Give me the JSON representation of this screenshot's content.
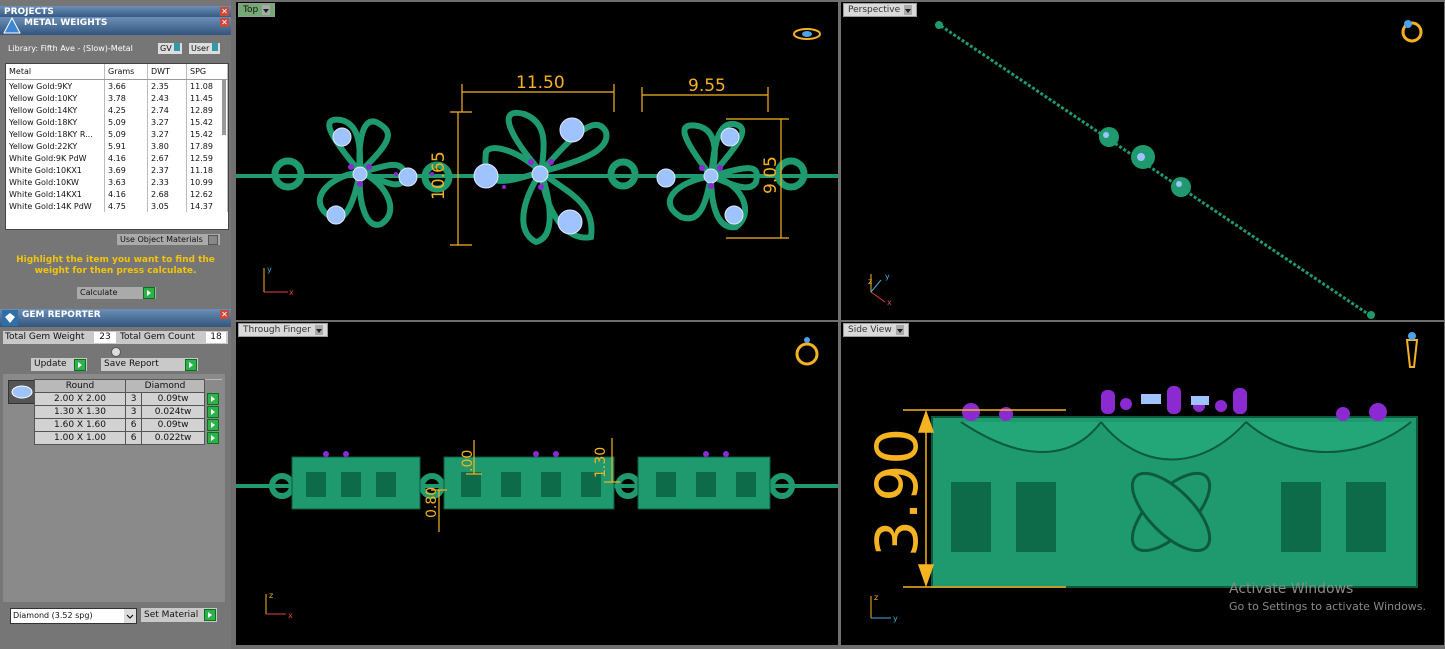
{
  "projects": {
    "title": "PROJECTS"
  },
  "metal_weights": {
    "title": "METAL WEIGHTS",
    "library": "Library: Fifth Ave - (Slow)-Metal",
    "gv_label": "GV",
    "user_label": "User",
    "columns": [
      "Metal",
      "Grams",
      "DWT",
      "SPG"
    ],
    "rows": [
      [
        "Yellow Gold:9KY",
        "3.66",
        "2.35",
        "11.08"
      ],
      [
        "Yellow Gold:10KY",
        "3.78",
        "2.43",
        "11.45"
      ],
      [
        "Yellow Gold:14KY",
        "4.25",
        "2.74",
        "12.89"
      ],
      [
        "Yellow Gold:18KY",
        "5.09",
        "3.27",
        "15.42"
      ],
      [
        "Yellow Gold:18KY R...",
        "5.09",
        "3.27",
        "15.42"
      ],
      [
        "Yellow Gold:22KY",
        "5.91",
        "3.80",
        "17.89"
      ],
      [
        "White Gold:9K PdW",
        "4.16",
        "2.67",
        "12.59"
      ],
      [
        "White Gold:10KX1",
        "3.69",
        "2.37",
        "11.18"
      ],
      [
        "White Gold:10KW",
        "3.63",
        "2.33",
        "10.99"
      ],
      [
        "White Gold:14KX1",
        "4.16",
        "2.68",
        "12.62"
      ],
      [
        "White Gold:14K PdW",
        "4.75",
        "3.05",
        "14.37"
      ]
    ],
    "use_object_materials": "Use Object Materials",
    "hint": "Highlight the item you want to find the weight for then press calculate.",
    "calculate": "Calculate"
  },
  "gem_reporter": {
    "title": "GEM REPORTER",
    "total_weight_label": "Total Gem Weight",
    "total_weight": "23",
    "total_count_label": "Total Gem Count",
    "total_count": "18",
    "update": "Update",
    "save_report": "Save Report",
    "columns": [
      "Round",
      "Diamond"
    ],
    "rows": [
      [
        "2.00 X 2.00",
        "3",
        "0.09tw"
      ],
      [
        "1.30 X 1.30",
        "3",
        "0.024tw"
      ],
      [
        "1.60 X 1.60",
        "6",
        "0.09tw"
      ],
      [
        "1.00 X 1.00",
        "6",
        "0.022tw"
      ]
    ],
    "material_select": "Diamond    (3.52 spg)",
    "set_material": "Set Material"
  },
  "viewports": {
    "top": {
      "label": "Top",
      "dims": [
        "11.50",
        "9.55",
        "10.65",
        "9.05"
      ]
    },
    "perspective": {
      "label": "Perspective"
    },
    "through_finger": {
      "label": "Through Finger",
      "dims": [
        ".00",
        "1.30",
        "0.80"
      ]
    },
    "side_view": {
      "label": "Side View",
      "dims": [
        "3.90"
      ]
    }
  },
  "axes": {
    "x": "x",
    "y": "y",
    "z": "z"
  },
  "watermark": {
    "title": "Activate Windows",
    "subtitle": "Go to Settings to activate Windows."
  },
  "colors": {
    "metal": "#1e9a6e",
    "gem": "#9fc3ff",
    "prong": "#8a2ad0",
    "dimension": "#f6b321"
  }
}
